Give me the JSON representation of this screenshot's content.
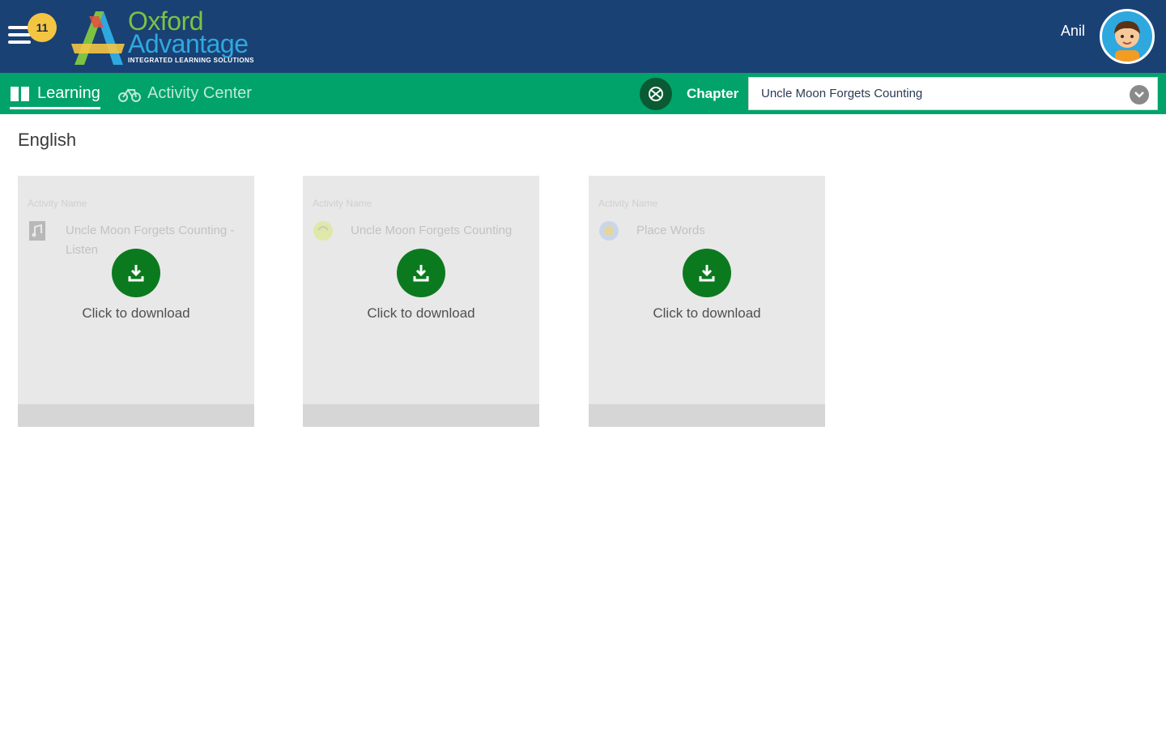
{
  "header": {
    "notification_count": "11",
    "logo": {
      "line1": "Oxford",
      "line2": "Advantage",
      "tagline": "INTEGRATED LEARNING SOLUTIONS"
    },
    "username": "Anil",
    "colors": {
      "background": "#1a4173",
      "badge": "#f4c542"
    }
  },
  "nav": {
    "tabs": [
      {
        "label": "Learning",
        "icon": "book-icon",
        "active": true
      },
      {
        "label": "Activity Center",
        "icon": "bicycle-icon",
        "active": false
      }
    ],
    "chapter_label": "Chapter",
    "chapter_value": "Uncle Moon Forgets Counting",
    "colors": {
      "background": "#01a36a"
    }
  },
  "subject": "English",
  "cards": [
    {
      "label": "Activity Name",
      "name": "Uncle Moon Forgets Counting - Listen",
      "type_icon": "audio-file-icon",
      "download_label": "Click to download"
    },
    {
      "label": "Activity Name",
      "name": "Uncle Moon Forgets Counting",
      "type_icon": "book-cover-icon",
      "download_label": "Click to download"
    },
    {
      "label": "Activity Name",
      "name": "Place Words",
      "type_icon": "globe-activity-icon",
      "download_label": "Click to download"
    }
  ],
  "accent": {
    "download_button": "#0b7a1f"
  }
}
